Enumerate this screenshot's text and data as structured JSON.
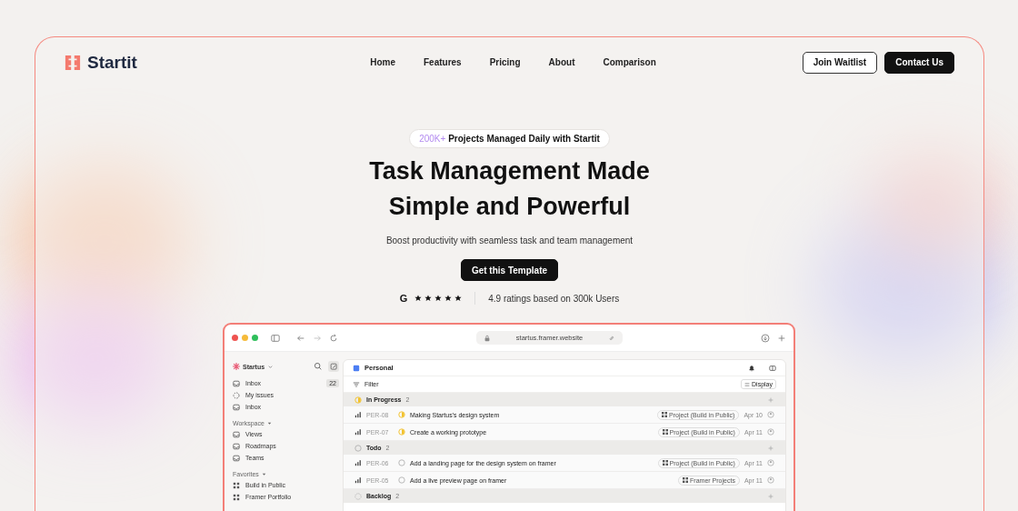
{
  "brand": {
    "name": "Startit"
  },
  "nav": [
    {
      "label": "Home"
    },
    {
      "label": "Features"
    },
    {
      "label": "Pricing"
    },
    {
      "label": "About"
    },
    {
      "label": "Comparison"
    }
  ],
  "actions": {
    "secondary": "Join Waitlist",
    "primary": "Contact Us"
  },
  "hero": {
    "badge_highlight": "200K+",
    "badge_text": "Projects Managed Daily with Startit",
    "title_lines": [
      "Task Management Made",
      "Simple and Powerful"
    ],
    "subtitle": "Boost productivity with seamless task and team management",
    "cta": "Get this Template",
    "rating_logo": "G",
    "stars": 5,
    "rating_text": "4.9 ratings based on 300k Users"
  },
  "app": {
    "url": "startus.framer.website",
    "workspace": "Startus",
    "sidebar": [
      {
        "items": [
          {
            "label": "Inbox",
            "badge": "22"
          },
          {
            "label": "My issues"
          },
          {
            "label": "Inbox"
          }
        ]
      },
      {
        "title": "Workspace",
        "items": [
          {
            "label": "Views"
          },
          {
            "label": "Roadmaps"
          },
          {
            "label": "Teams"
          }
        ]
      },
      {
        "title": "Favorites",
        "items": [
          {
            "label": "Build in Public"
          },
          {
            "label": "Framer Portfolio"
          }
        ]
      }
    ],
    "view": "Personal",
    "filter": "Filter",
    "display": "Display",
    "groups": [
      {
        "kind": "in_progress",
        "name": "In Progress",
        "count": "2",
        "tasks": [
          {
            "id": "PER-08",
            "title": "Making Startus's design system",
            "project": "Project (Build in Public)",
            "date": "Apr 10"
          },
          {
            "id": "PER-07",
            "title": "Create a working prototype",
            "project": "Project (Build in Public)",
            "date": "Apr 11"
          }
        ]
      },
      {
        "kind": "todo",
        "name": "Todo",
        "count": "2",
        "tasks": [
          {
            "id": "PER-06",
            "title": "Add a landing page for the design system on framer",
            "project": "Project (Build in Public)",
            "date": "Apr 11"
          },
          {
            "id": "PER-05",
            "title": "Add a live preview page on framer",
            "project": "Framer Projects",
            "date": "Apr 11"
          }
        ]
      },
      {
        "kind": "backlog",
        "name": "Backlog",
        "count": "2"
      }
    ]
  }
}
